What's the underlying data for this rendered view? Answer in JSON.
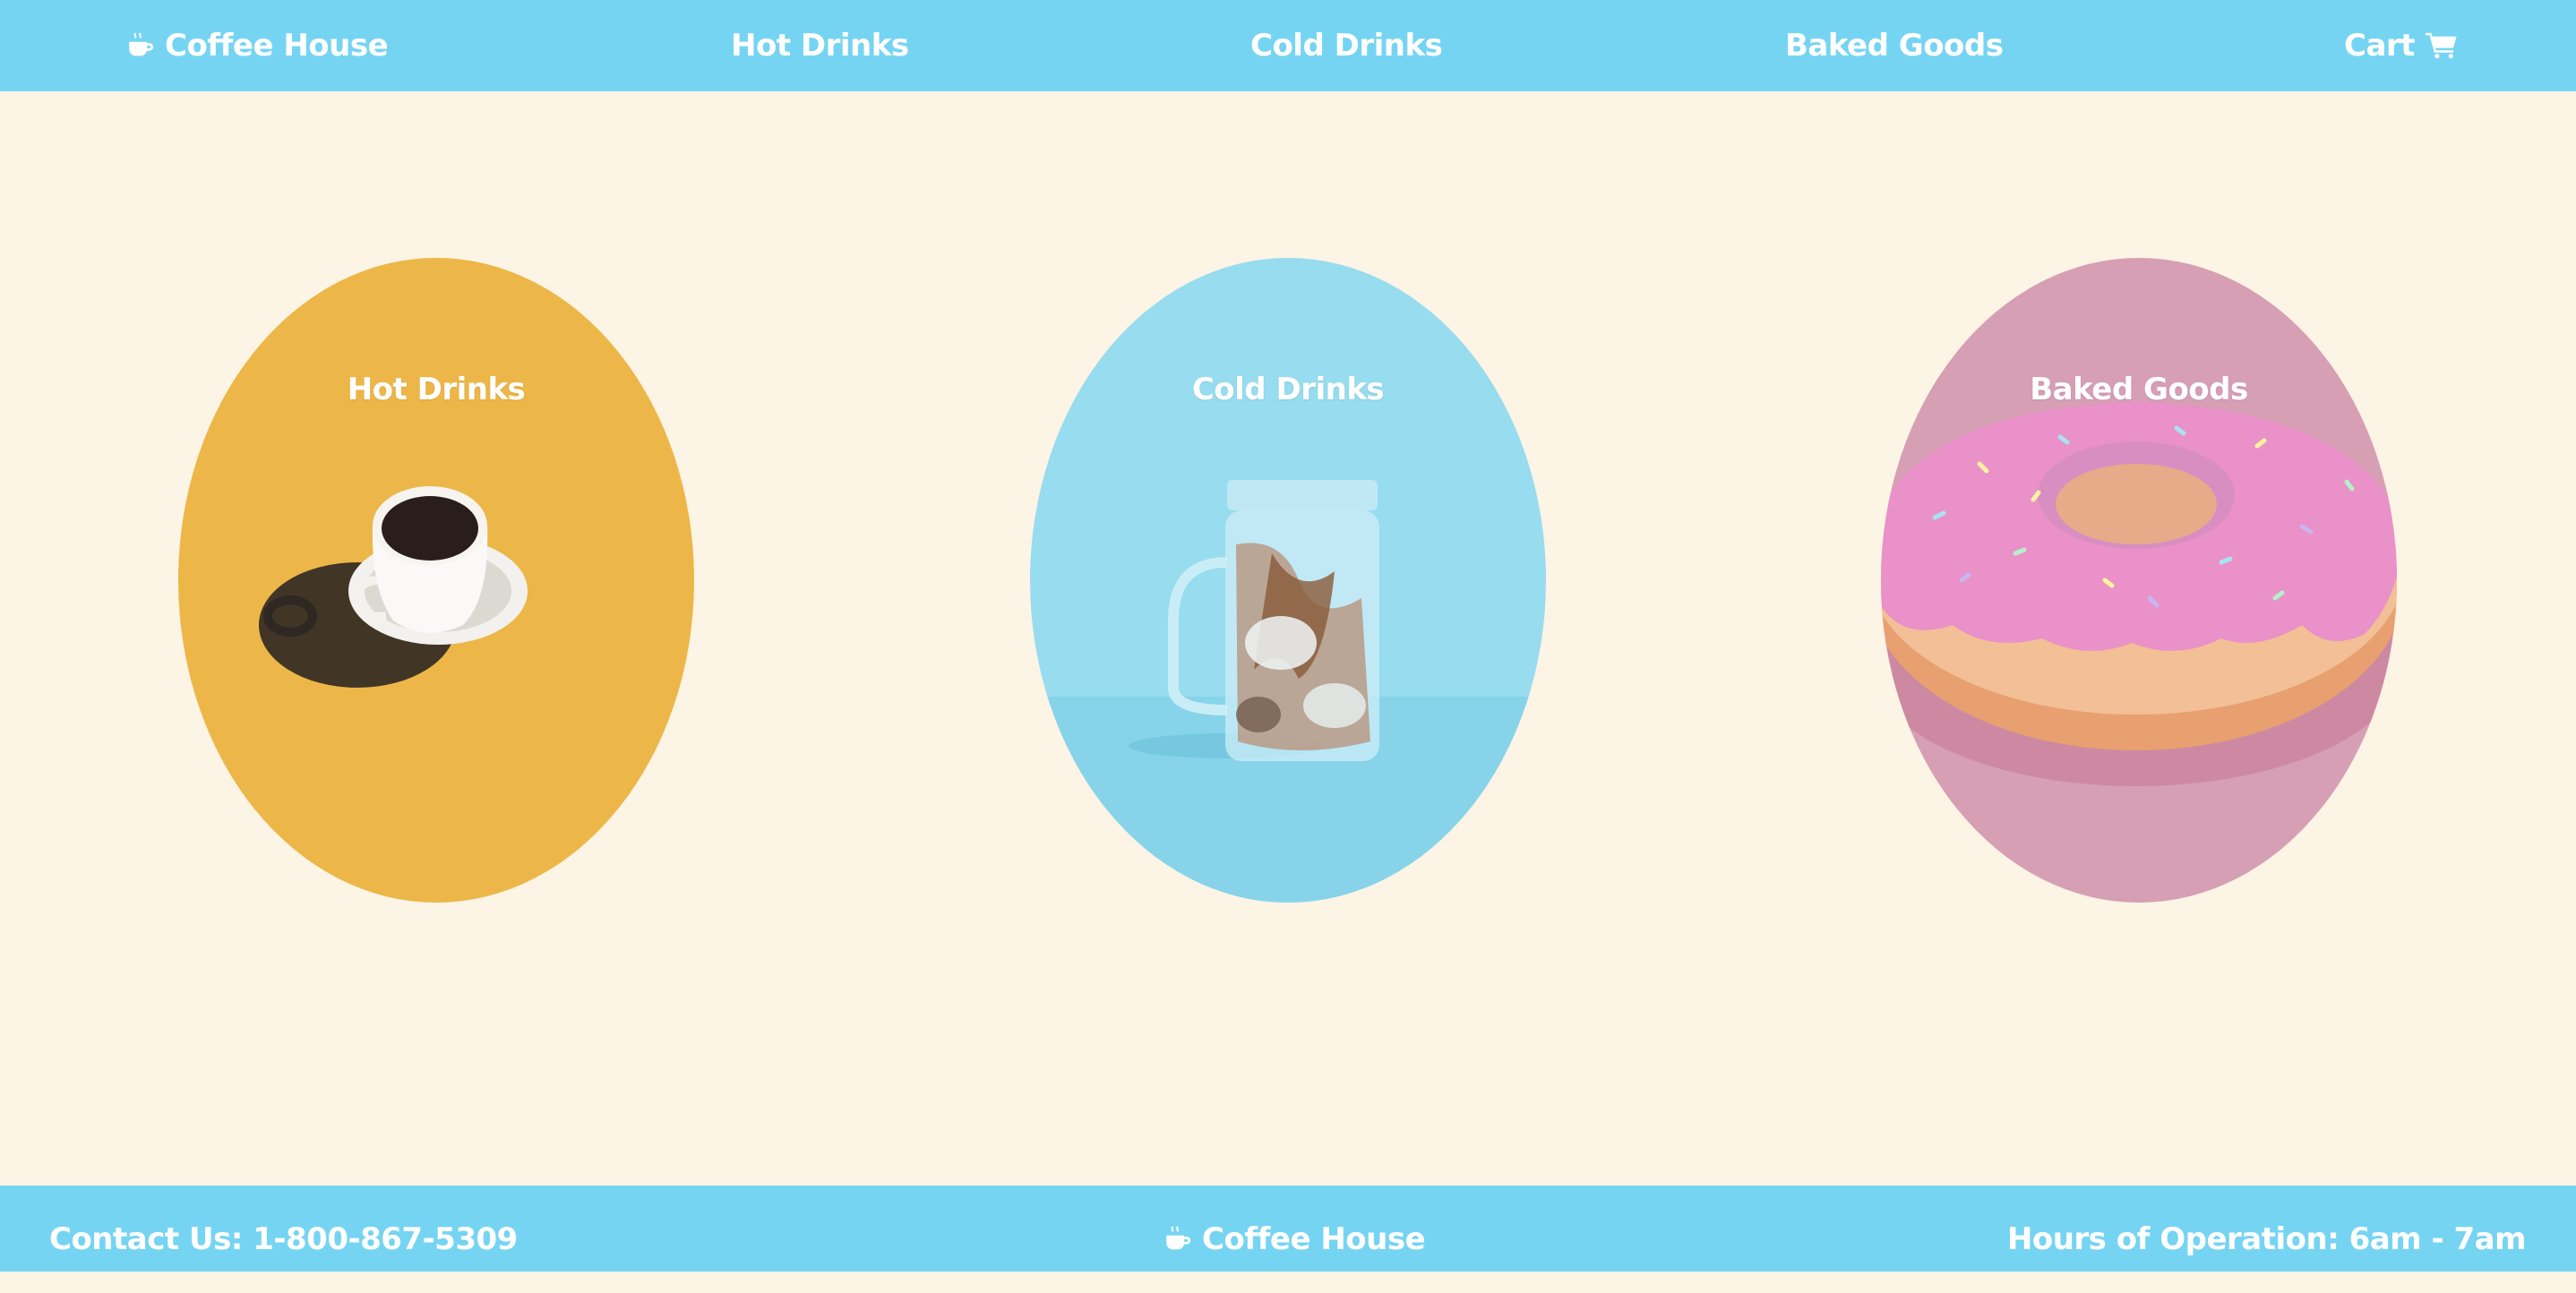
{
  "nav": {
    "brand": "Coffee House",
    "hot_drinks": "Hot Drinks",
    "cold_drinks": "Cold Drinks",
    "baked_goods": "Baked Goods",
    "cart": "Cart",
    "icons": {
      "brand": "coffee-cup-icon",
      "cart": "shopping-cart-icon"
    }
  },
  "cards": [
    {
      "label": "Hot Drinks",
      "color": "#ecb748",
      "image": "coffee-cup-on-saucer"
    },
    {
      "label": "Cold Drinks",
      "color": "#97dcef",
      "image": "iced-coffee-mason-jar"
    },
    {
      "label": "Baked Goods",
      "color": "#d69fb4",
      "image": "pink-sprinkled-donut"
    }
  ],
  "footer": {
    "contact": "Contact Us: 1-800-867-5309",
    "brand": "Coffee House",
    "hours": "Hours of Operation: 6am - 7am"
  },
  "colors": {
    "bar": "#76d4f3",
    "background": "#fcf4e5",
    "text": "#ffffff"
  }
}
